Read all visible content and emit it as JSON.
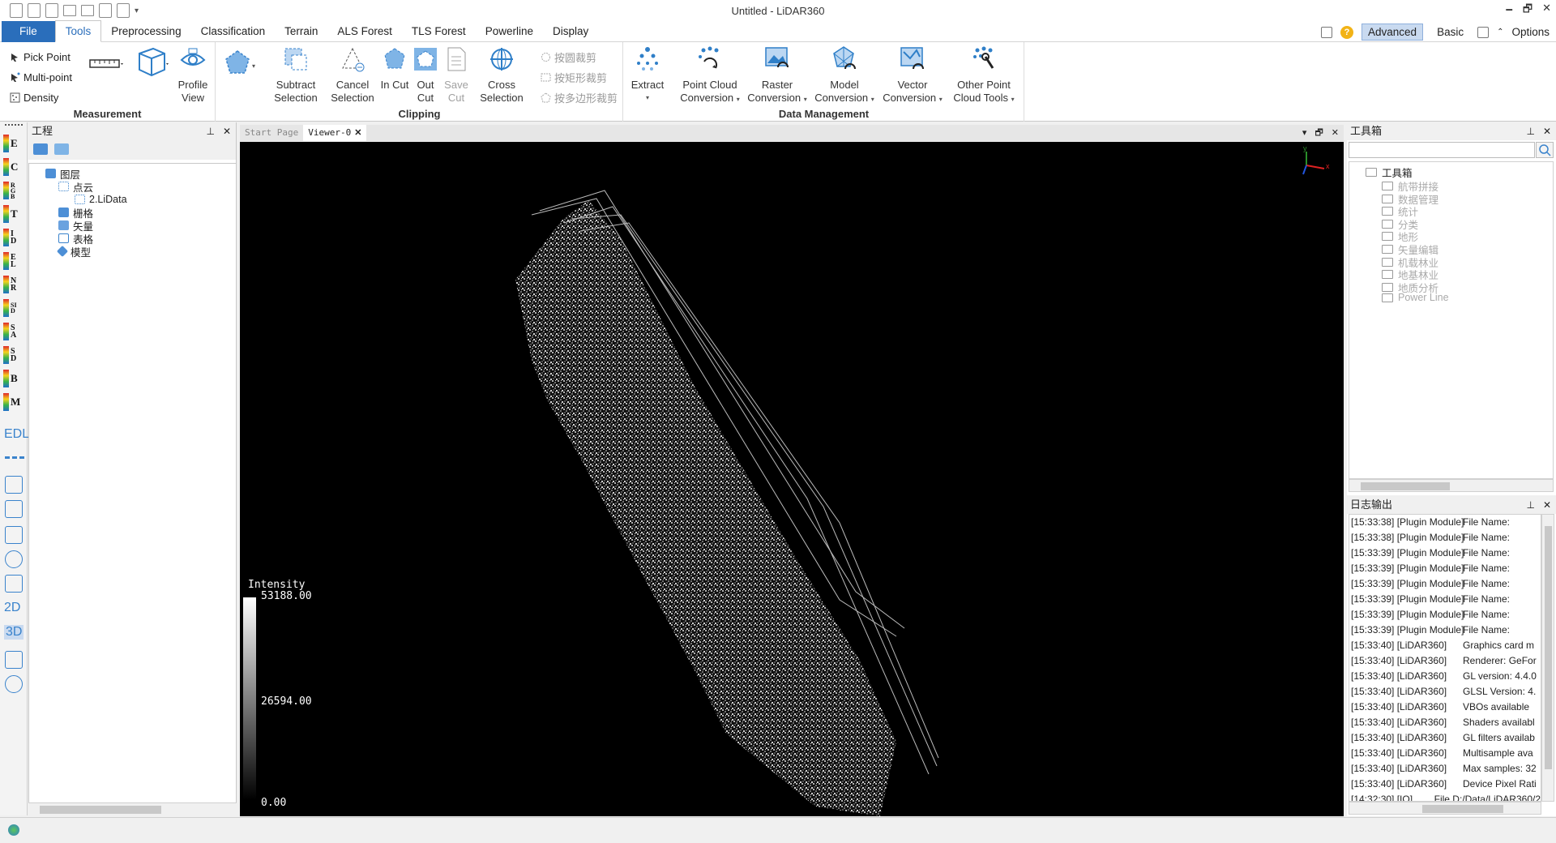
{
  "window": {
    "title": "Untitled - LiDAR360",
    "controls": [
      "🗕",
      "🗗",
      "✕"
    ]
  },
  "menu": {
    "tabs": [
      "File",
      "Tools",
      "Preprocessing",
      "Classification",
      "Terrain",
      "ALS Forest",
      "TLS Forest",
      "Powerline",
      "Display"
    ],
    "active": "Tools",
    "modes": {
      "advanced": "Advanced",
      "basic": "Basic"
    },
    "options": "Options"
  },
  "ribbon": {
    "measurement": {
      "label": "Measurement",
      "pick_point": "Pick Point",
      "multi_point": "Multi-point",
      "density": "Density",
      "profile_view": [
        "Profile",
        "View"
      ]
    },
    "clipping": {
      "label": "Clipping",
      "subtract_selection": [
        "Subtract",
        "Selection"
      ],
      "cancel_selection": [
        "Cancel",
        "Selection"
      ],
      "in_cut": [
        "In Cut",
        ""
      ],
      "out_cut": [
        "Out",
        "Cut"
      ],
      "save_cut": [
        "Save",
        "Cut"
      ],
      "cross_selection": [
        "Cross",
        "Selection"
      ],
      "clip_circle": "按圆裁剪",
      "clip_rect": "按矩形裁剪",
      "clip_polygon": "按多边形裁剪"
    },
    "data_management": {
      "label": "Data Management",
      "extract": "Extract",
      "point_cloud_conversion": [
        "Point Cloud",
        "Conversion"
      ],
      "raster_conversion": [
        "Raster",
        "Conversion"
      ],
      "model_conversion": [
        "Model",
        "Conversion"
      ],
      "vector_conversion": [
        "Vector",
        "Conversion"
      ],
      "other_point_cloud_tools": [
        "Other Point",
        "Cloud Tools"
      ]
    }
  },
  "left_toolbar": {
    "color_modes": [
      "E",
      "C",
      "RGB",
      "T",
      "ID",
      "EL",
      "NR",
      "SID",
      "SA",
      "SD",
      "B",
      "M"
    ],
    "edl": "EDL",
    "view_2d": "2D",
    "view_3d": "3D"
  },
  "project_panel": {
    "title": "工程",
    "tree": {
      "root": "图层",
      "point_cloud": "点云",
      "file": "2.LiData",
      "raster": "栅格",
      "vector": "矢量",
      "table": "表格",
      "model": "模型"
    }
  },
  "viewer": {
    "tabs": [
      "Start Page",
      "Viewer-0"
    ],
    "legend": {
      "title": "Intensity",
      "max": "53188.00",
      "mid": "26594.00",
      "min": "0.00"
    },
    "axes": {
      "x": "x",
      "y": "y"
    }
  },
  "toolbox": {
    "title": "工具箱",
    "root": "工具箱",
    "items": [
      "航带拼接",
      "数据管理",
      "统计",
      "分类",
      "地形",
      "矢量编辑",
      "机载林业",
      "地基林业",
      "地质分析",
      "Power Line"
    ]
  },
  "log": {
    "title": "日志输出",
    "rows": [
      {
        "time": "[15:33:38] [Plugin Module]",
        "msg": "File Name:"
      },
      {
        "time": "[15:33:38] [Plugin Module]",
        "msg": "File Name:"
      },
      {
        "time": "[15:33:39] [Plugin Module]",
        "msg": "File Name:"
      },
      {
        "time": "[15:33:39] [Plugin Module]",
        "msg": "File Name:"
      },
      {
        "time": "[15:33:39] [Plugin Module]",
        "msg": "File Name:"
      },
      {
        "time": "[15:33:39] [Plugin Module]",
        "msg": "File Name:"
      },
      {
        "time": "[15:33:39] [Plugin Module]",
        "msg": "File Name:"
      },
      {
        "time": "[15:33:39] [Plugin Module]",
        "msg": "File Name:"
      },
      {
        "time": "[15:33:40] [LiDAR360]",
        "msg": "Graphics card m"
      },
      {
        "time": "[15:33:40] [LiDAR360]",
        "msg": "Renderer: GeFor"
      },
      {
        "time": "[15:33:40] [LiDAR360]",
        "msg": "GL version: 4.4.0"
      },
      {
        "time": "[15:33:40] [LiDAR360]",
        "msg": "GLSL Version: 4."
      },
      {
        "time": "[15:33:40] [LiDAR360]",
        "msg": "VBOs available"
      },
      {
        "time": "[15:33:40] [LiDAR360]",
        "msg": "Shaders availabl"
      },
      {
        "time": "[15:33:40] [LiDAR360]",
        "msg": "GL filters availab"
      },
      {
        "time": "[15:33:40] [LiDAR360]",
        "msg": "Multisample ava"
      },
      {
        "time": "[15:33:40] [LiDAR360]",
        "msg": "Max samples: 32"
      },
      {
        "time": "[15:33:40] [LiDAR360]",
        "msg": "Device Pixel Rati"
      },
      {
        "time": "[14:32:30] [IO]",
        "msg": "File D:/Data/LiDAR360/2"
      }
    ]
  }
}
